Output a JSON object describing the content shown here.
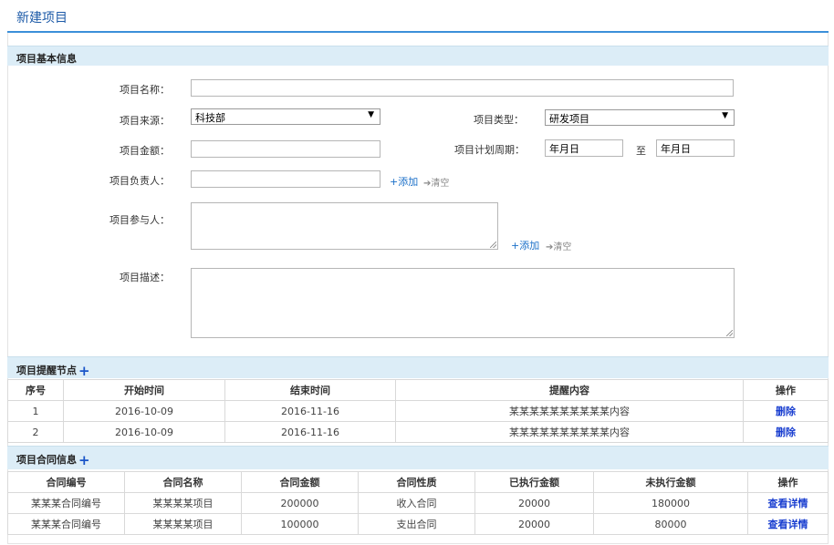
{
  "page": {
    "title": "新建项目"
  },
  "basic": {
    "section_title": "项目基本信息",
    "name_label": "项目名称：",
    "name_value": "",
    "source_label": "项目来源：",
    "source_value": "科技部",
    "type_label": "项目类型：",
    "type_value": "研发项目",
    "amount_label": "项目金额：",
    "amount_value": "",
    "period_label": "项目计划周期：",
    "period_start": "年月日",
    "period_sep": "至",
    "period_end": "年月日",
    "leader_label": "项目负责人：",
    "participants_label": "项目参与人：",
    "desc_label": "项目描述：",
    "add_label": "+添加",
    "clear_label": "➔清空"
  },
  "reminders": {
    "section_title": "项目提醒节点",
    "columns": [
      "序号",
      "开始时间",
      "结束时间",
      "提醒内容",
      "操作"
    ],
    "rows": [
      {
        "no": "1",
        "start": "2016-10-09",
        "end": "2016-11-16",
        "content": "某某某某某某某某某某内容",
        "action": "删除"
      },
      {
        "no": "2",
        "start": "2016-10-09",
        "end": "2016-11-16",
        "content": "某某某某某某某某某某内容",
        "action": "删除"
      }
    ]
  },
  "contracts": {
    "section_title": "项目合同信息",
    "columns": [
      "合同编号",
      "合同名称",
      "合同金额",
      "合同性质",
      "已执行金额",
      "未执行金额",
      "操作"
    ],
    "rows": [
      {
        "code": "某某某合同编号",
        "name": "某某某某项目",
        "amount": "200000",
        "nature": "收入合同",
        "executed": "20000",
        "remaining": "180000",
        "action": "查看详情"
      },
      {
        "code": "某某某合同编号",
        "name": "某某某某项目",
        "amount": "100000",
        "nature": "支出合同",
        "executed": "20000",
        "remaining": "80000",
        "action": "查看详情"
      }
    ]
  },
  "colors": {
    "accent": "#3b8fd9",
    "section_bg": "#dcedf7",
    "link": "#1a3fd0"
  },
  "icons": [
    "plus-icon",
    "dropdown-arrow-icon",
    "resize-grip-icon"
  ]
}
